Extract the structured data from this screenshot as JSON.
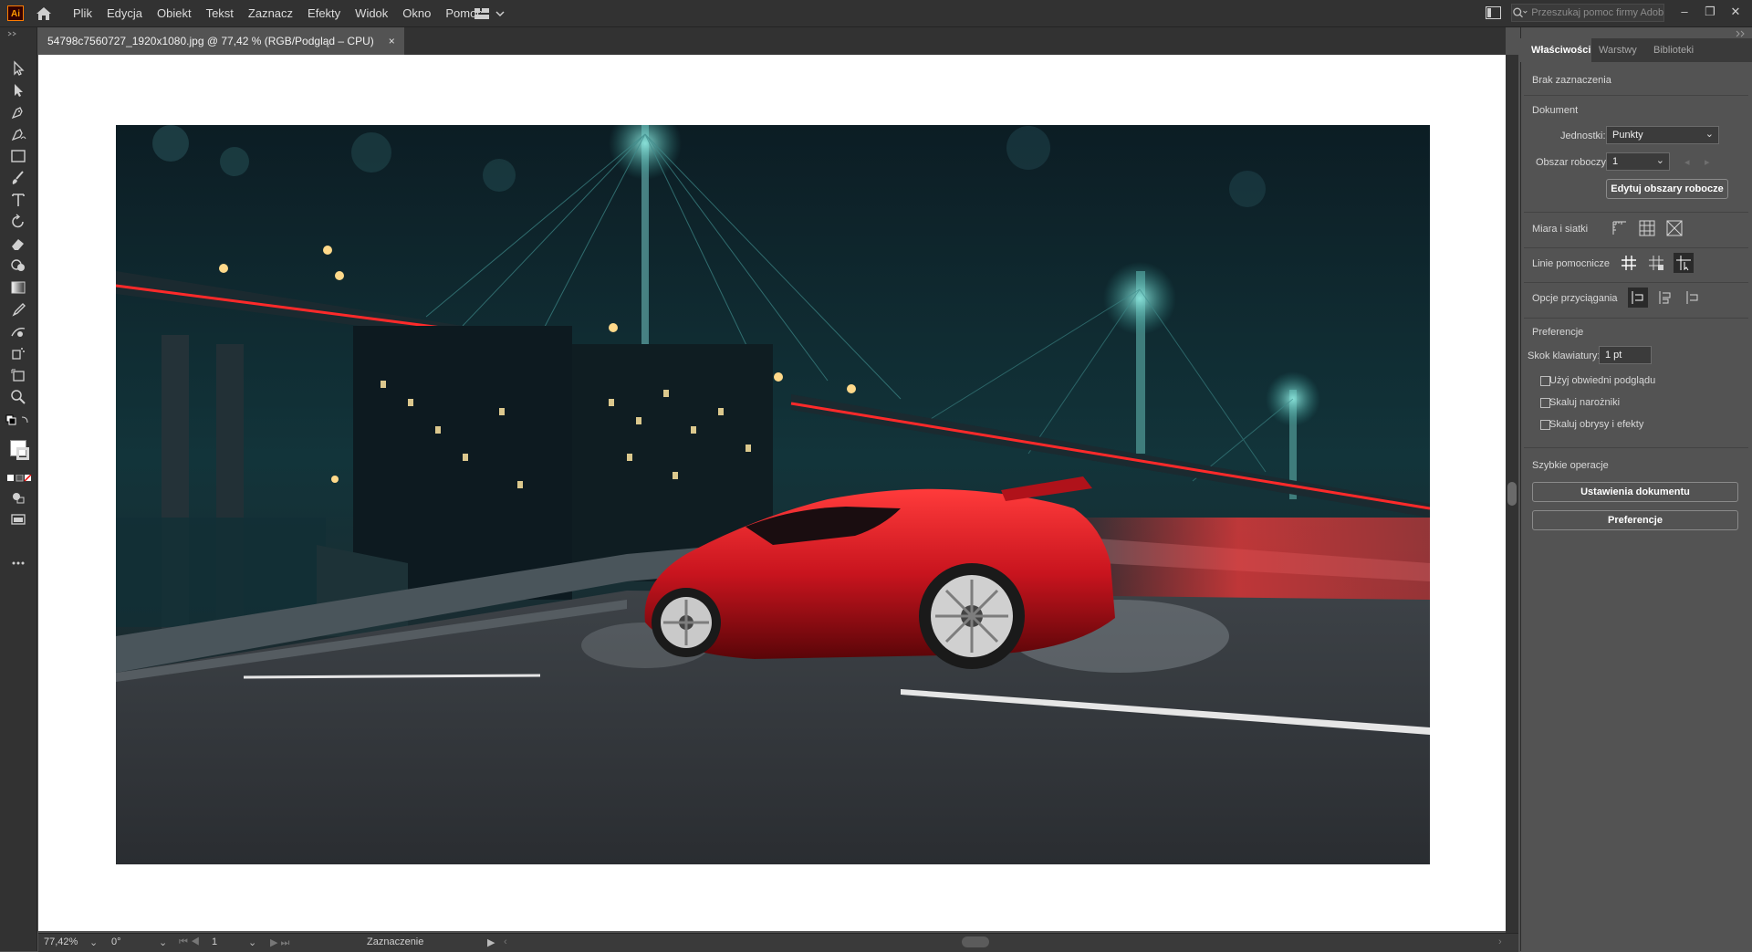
{
  "app": {
    "logo": "Ai"
  },
  "menu": [
    "Plik",
    "Edycja",
    "Obiekt",
    "Tekst",
    "Zaznacz",
    "Efekty",
    "Widok",
    "Okno",
    "Pomoc"
  ],
  "search": {
    "placeholder": "Przeszukaj pomoc firmy Adobe"
  },
  "window_buttons": {
    "minimize": "–",
    "restore": "❐",
    "close": "✕"
  },
  "document": {
    "tab_title": "54798c7560727_1920x1080.jpg @ 77,42 % (RGB/Podgląd – CPU)",
    "tab_close": "×"
  },
  "status": {
    "zoom": "77,42%",
    "rotation": "0°",
    "artboard_num": "1",
    "tool_name": "Zaznaczenie"
  },
  "panel": {
    "tabs": [
      "Właściwości",
      "Warstwy",
      "Biblioteki"
    ],
    "no_selection": "Brak zaznaczenia",
    "document_heading": "Dokument",
    "units_label": "Jednostki:",
    "units_value": "Punkty",
    "artboard_label": "Obszar roboczy:",
    "artboard_value": "1",
    "edit_artboards_button": "Edytuj obszary robocze",
    "rulers_grids_label": "Miara i siatki",
    "guides_label": "Linie pomocnicze",
    "snap_label": "Opcje przyciągania",
    "preferences_heading": "Preferencje",
    "keyboard_increment_label": "Skok klawiatury:",
    "keyboard_increment_value": "1 pt",
    "checkboxes": [
      "Użyj obwiedni podglądu",
      "Skaluj narożniki",
      "Skaluj obrysy i efekty"
    ],
    "quick_actions_heading": "Szybkie operacje",
    "document_setup_button": "Ustawienia dokumentu",
    "preferences_button": "Preferencje"
  },
  "colors": {
    "chrome_dark": "#323232",
    "chrome_mid": "#535353",
    "ai_orange": "#ff9a00",
    "car_red": "#c8141e"
  }
}
